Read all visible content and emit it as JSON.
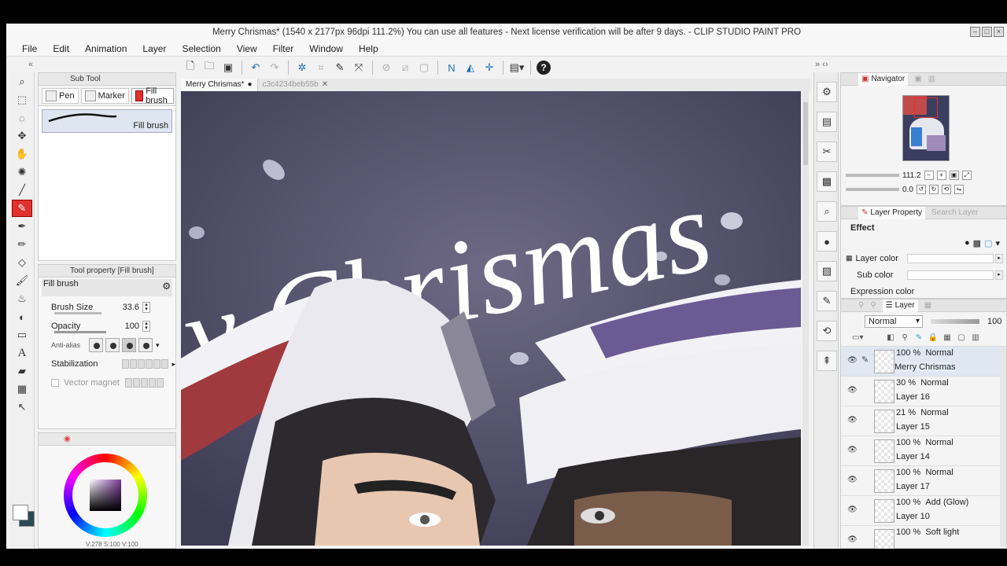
{
  "window": {
    "title": "Merry Chrismas* (1540 x 2177px 96dpi 111.2%)  You can use all features - Next license verification will be after 9 days. - CLIP STUDIO PAINT PRO"
  },
  "menu": [
    "File",
    "Edit",
    "Animation",
    "Layer",
    "Selection",
    "View",
    "Filter",
    "Window",
    "Help"
  ],
  "subtool": {
    "header": "Sub Tool",
    "tabs": [
      "Pen",
      "Marker",
      "Fill brush"
    ],
    "brush_name": "Fill brush"
  },
  "tool_property": {
    "header": "Tool property [Fill brush]",
    "name": "Fill brush",
    "brush_size_label": "Brush Size",
    "brush_size": "33.6",
    "opacity_label": "Opacity",
    "opacity": "100",
    "antialias_label": "Anti-alias",
    "stabilization_label": "Stabilization",
    "vector_magnet_label": "Vector magnet"
  },
  "color_panel": {
    "fg_color": "#ffffff",
    "bg_color": "#2a4a55",
    "footer": "V:278 S:100 V:100"
  },
  "document_tabs": [
    "Merry Chrismas*",
    "c3c4234beb55b"
  ],
  "canvas": {
    "text": "y Chrismas"
  },
  "navigator": {
    "tab": "Navigator",
    "zoom": "111.2",
    "rotation": "0.0"
  },
  "layer_property": {
    "tab": "Layer Property",
    "search_tab": "Search Layer",
    "effect_label": "Effect",
    "layer_color_label": "Layer color",
    "sub_color_label": "Sub color",
    "expression_color_label": "Expression color"
  },
  "layer_panel": {
    "tab": "Layer",
    "blend_mode": "Normal",
    "opacity": "100",
    "layers": [
      {
        "opacity": "100 %",
        "mode": "Normal",
        "name": "Merry Chrismas",
        "selected": true
      },
      {
        "opacity": "30 %",
        "mode": "Normal",
        "name": "Layer 16",
        "selected": false
      },
      {
        "opacity": "21 %",
        "mode": "Normal",
        "name": "Layer 15",
        "selected": false
      },
      {
        "opacity": "100 %",
        "mode": "Normal",
        "name": "Layer 14",
        "selected": false
      },
      {
        "opacity": "100 %",
        "mode": "Normal",
        "name": "Layer 17",
        "selected": false
      },
      {
        "opacity": "100 %",
        "mode": "Add (Glow)",
        "name": "Layer 10",
        "selected": false
      },
      {
        "opacity": "100 %",
        "mode": "Soft light",
        "name": "",
        "selected": false
      }
    ]
  }
}
